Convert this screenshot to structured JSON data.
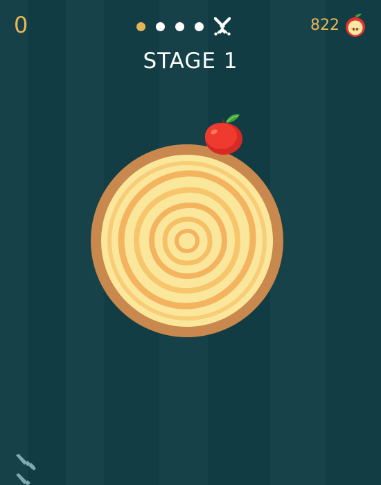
{
  "hud": {
    "score": "0",
    "stage_title": "STAGE 1",
    "apple_count": "822",
    "stage_progress": {
      "completed": 1,
      "total_dots": 4,
      "boss_icon": "crossed-swords-icon"
    }
  },
  "colors": {
    "background": "#123e45",
    "accent_gold": "#e8b75a",
    "target_rim": "#c9884d",
    "target_face": "#fbe79c",
    "target_rings": "#f3b35f",
    "apple_red": "#e5322d",
    "leaf_green": "#3fa23a"
  },
  "icons": {
    "apple_counter": "apple-icon",
    "apple_on_target": "apple-icon",
    "remaining_knives": "knife-icon"
  },
  "remaining_knives_visible": 2
}
